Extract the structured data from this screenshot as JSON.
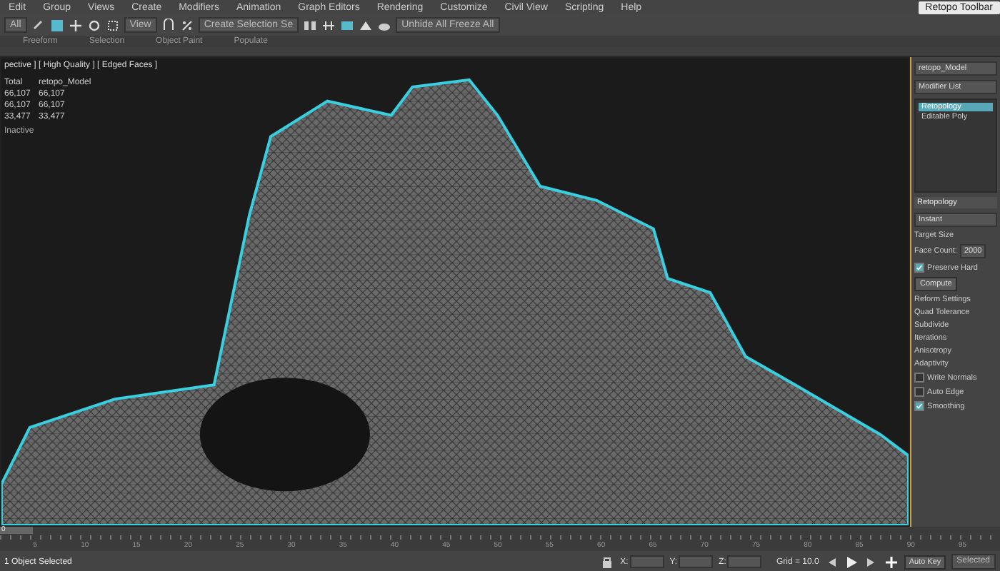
{
  "menu": [
    "Edit",
    "Group",
    "Views",
    "Create",
    "Modifiers",
    "Animation",
    "Graph Editors",
    "Rendering",
    "Customize",
    "Civil View",
    "Scripting",
    "Help"
  ],
  "workspace": "Retopo Toolbar",
  "toolbar": {
    "selection_filter": "All",
    "reference_coord": "View",
    "named_selection": "Create Selection Se",
    "layer": "Unhide All  Freeze All"
  },
  "ribbon_tabs": [
    {
      "label": "Freeform",
      "selected": false
    },
    {
      "label": "Selection",
      "selected": false
    },
    {
      "label": "Object Paint",
      "selected": false
    },
    {
      "label": "Populate",
      "selected": false
    }
  ],
  "viewport": {
    "label": "pective ] [ High Quality ] [ Edged Faces ]",
    "stats_header": [
      "Total",
      "retopo_Model"
    ],
    "stats_rows": [
      [
        "66,107",
        "66,107"
      ],
      [
        "66,107",
        "66,107"
      ],
      [
        "33,477",
        "33,477"
      ]
    ],
    "note": "Inactive"
  },
  "command_panel": {
    "object_name": "retopo_Model",
    "modifier_list": "Modifier List",
    "stack": [
      {
        "label": "Retopology",
        "selected": true
      },
      {
        "label": "Editable Poly",
        "selected": false
      }
    ],
    "rollout": "Retopology",
    "preset": "Instant",
    "target_label": "Target Size",
    "face_count_label": "Face Count:",
    "face_count": "2000",
    "options": [
      {
        "kind": "check",
        "label": "Preserve Hard",
        "checked": true
      },
      {
        "kind": "button",
        "label": "Compute"
      },
      {
        "kind": "text",
        "label": "Reform Settings"
      },
      {
        "kind": "text",
        "label": "Quad Tolerance"
      },
      {
        "kind": "text",
        "label": "Subdivide"
      },
      {
        "kind": "text",
        "label": "Iterations"
      },
      {
        "kind": "text",
        "label": "Anisotropy"
      },
      {
        "kind": "text",
        "label": "Adaptivity"
      },
      {
        "kind": "check",
        "label": "Write Normals",
        "checked": false
      },
      {
        "kind": "check",
        "label": "Auto Edge",
        "checked": false
      },
      {
        "kind": "check",
        "label": "Smoothing",
        "checked": true
      }
    ]
  },
  "timeline": {
    "frame": "0",
    "level": 0,
    "ticks": [
      "5",
      "10",
      "15",
      "20",
      "25",
      "30",
      "35",
      "40",
      "45",
      "50",
      "55",
      "60",
      "65",
      "70",
      "75",
      "80",
      "85",
      "90",
      "95"
    ]
  },
  "status_bar": {
    "message": "1 Object Selected",
    "x_label": "X:",
    "y_label": "Y:",
    "z_label": "Z:",
    "grid": "Grid = 10.0",
    "auto_key": "Auto Key",
    "key_mode": "Selected"
  }
}
